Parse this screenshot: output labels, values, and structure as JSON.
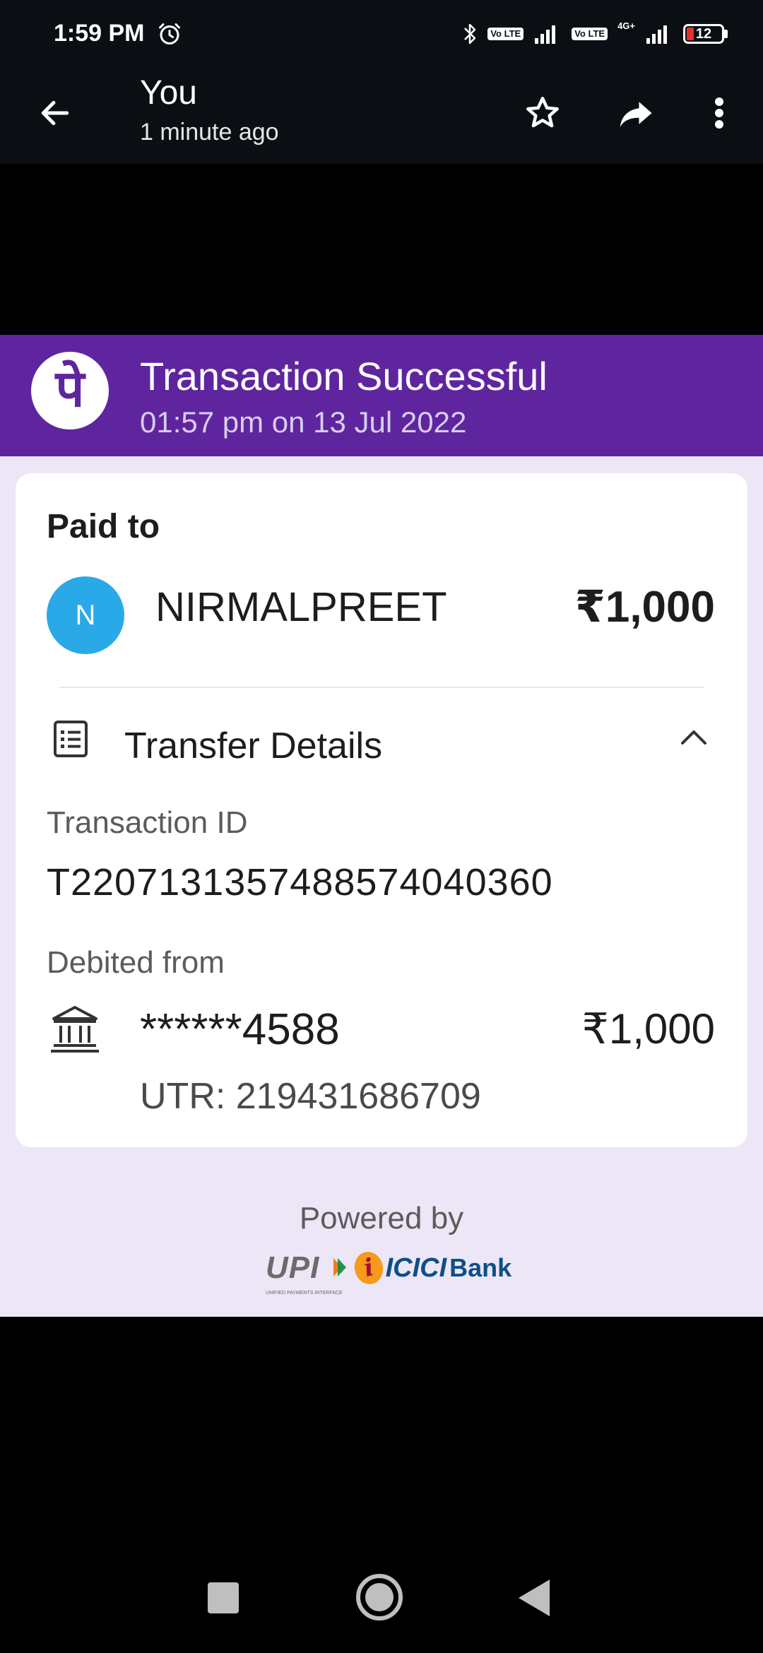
{
  "status_bar": {
    "time": "1:59 PM",
    "lte1": "Vo LTE",
    "lte2": "Vo LTE",
    "net_type": "4G+",
    "battery": "12"
  },
  "app_bar": {
    "title": "You",
    "subtitle": "1 minute ago"
  },
  "receipt": {
    "status_title": "Transaction Successful",
    "status_datetime": "01:57 pm on 13 Jul 2022",
    "logo_glyph": "पे",
    "paid_to_label": "Paid to",
    "payee_initial": "N",
    "payee_name": "NIRMALPREET",
    "amount": "₹1,000",
    "transfer_details_label": "Transfer Details",
    "transaction_id_label": "Transaction ID",
    "transaction_id": "T2207131357488574040360",
    "debited_from_label": "Debited from",
    "account_masked": "******4588",
    "debited_amount": "₹1,000",
    "utr": "UTR: 219431686709",
    "powered_by": "Powered by",
    "upi_text": "UPI",
    "upi_tagline": "UNIFIED PAYMENTS INTERFACE",
    "icici_logo_letter": "i",
    "bank_name_1": "ICICI",
    "bank_name_2": "Bank"
  },
  "colors": {
    "brand_purple": "#5f259f",
    "avatar_blue": "#2aa9e8",
    "receipt_bg": "#ece6f6"
  }
}
